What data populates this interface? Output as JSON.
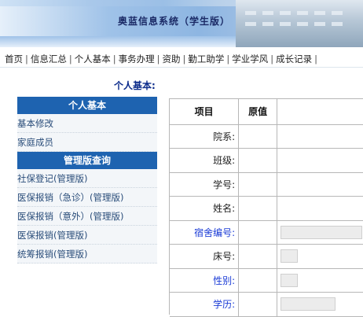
{
  "banner": {
    "title": "奥蓝信息系统（学生版）"
  },
  "nav": {
    "items": [
      "首页",
      "信息汇总",
      "个人基本",
      "事务办理",
      "资助",
      "勤工助学",
      "学业学风",
      "成长记录"
    ],
    "separator": "|"
  },
  "section_title": "个人基本:",
  "sidebar": {
    "head1": "个人基本",
    "group1": [
      "基本修改",
      "家庭成员"
    ],
    "head2": "管理版查询",
    "group2": [
      "社保登记(管理版)",
      "医保报销（急诊）(管理版)",
      "医保报销（意外）(管理版)",
      "医保报销(管理版)",
      "统筹报销(管理版)"
    ]
  },
  "table": {
    "headers": [
      "项目",
      "原值",
      ""
    ],
    "rows": [
      {
        "label": "院系:",
        "blue": false,
        "box": 0
      },
      {
        "label": "班级:",
        "blue": false,
        "box": 0
      },
      {
        "label": "学号:",
        "blue": false,
        "box": 0
      },
      {
        "label": "姓名:",
        "blue": false,
        "box": 0
      },
      {
        "label": "宿舍编号:",
        "blue": true,
        "box": 1
      },
      {
        "label": "床号:",
        "blue": false,
        "box": 2
      },
      {
        "label": "性别:",
        "blue": true,
        "box": 2
      },
      {
        "label": "学历:",
        "blue": true,
        "box": 3
      }
    ]
  },
  "colors": {
    "accent": "#1e63b0",
    "link_blue": "#1a3bd6",
    "section_blue": "#0a2a8a"
  }
}
